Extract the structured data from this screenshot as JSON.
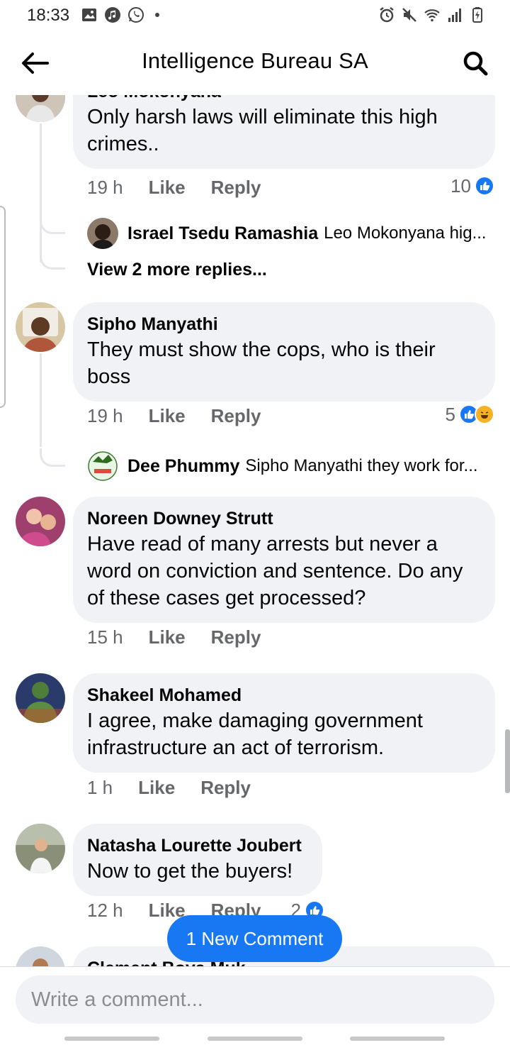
{
  "status_bar": {
    "time": "18:33"
  },
  "header": {
    "title": "Intelligence Bureau SA"
  },
  "comments": [
    {
      "author": "Leo Mokonyana",
      "text": "Only harsh laws will eliminate this high crimes..",
      "time": "19 h",
      "like_label": "Like",
      "reply_label": "Reply",
      "reaction_count": "10",
      "replies": [
        {
          "author": "Israel Tsedu Ramashia",
          "snippet": "Leo Mokonyana hig..."
        }
      ],
      "more_replies": "View 2 more replies..."
    },
    {
      "author": "Sipho Manyathi",
      "text": "They must show the cops, who is their boss",
      "time": "19 h",
      "like_label": "Like",
      "reply_label": "Reply",
      "reaction_count": "5",
      "replies": [
        {
          "author": "Dee Phummy",
          "snippet": "Sipho Manyathi they work for..."
        }
      ]
    },
    {
      "author": "Noreen Downey Strutt",
      "text": "Have read of many arrests but never a word on conviction and sentence. Do any of these cases get processed?",
      "time": "15 h",
      "like_label": "Like",
      "reply_label": "Reply"
    },
    {
      "author": "Shakeel Mohamed",
      "text": "I agree, make damaging government infrastructure an act of terrorism.",
      "time": "1 h",
      "like_label": "Like",
      "reply_label": "Reply"
    },
    {
      "author": "Natasha Lourette Joubert",
      "text": "Now to get the buyers!",
      "time": "12 h",
      "like_label": "Like",
      "reply_label": "Reply",
      "reaction_count": "2"
    },
    {
      "author": "Clement Boya Muk"
    }
  ],
  "new_comment_pill": "1 New Comment",
  "composer": {
    "placeholder": "Write a comment..."
  },
  "colors": {
    "accent": "#1877f2",
    "bubble": "#f0f2f5",
    "meta": "#65676b"
  }
}
